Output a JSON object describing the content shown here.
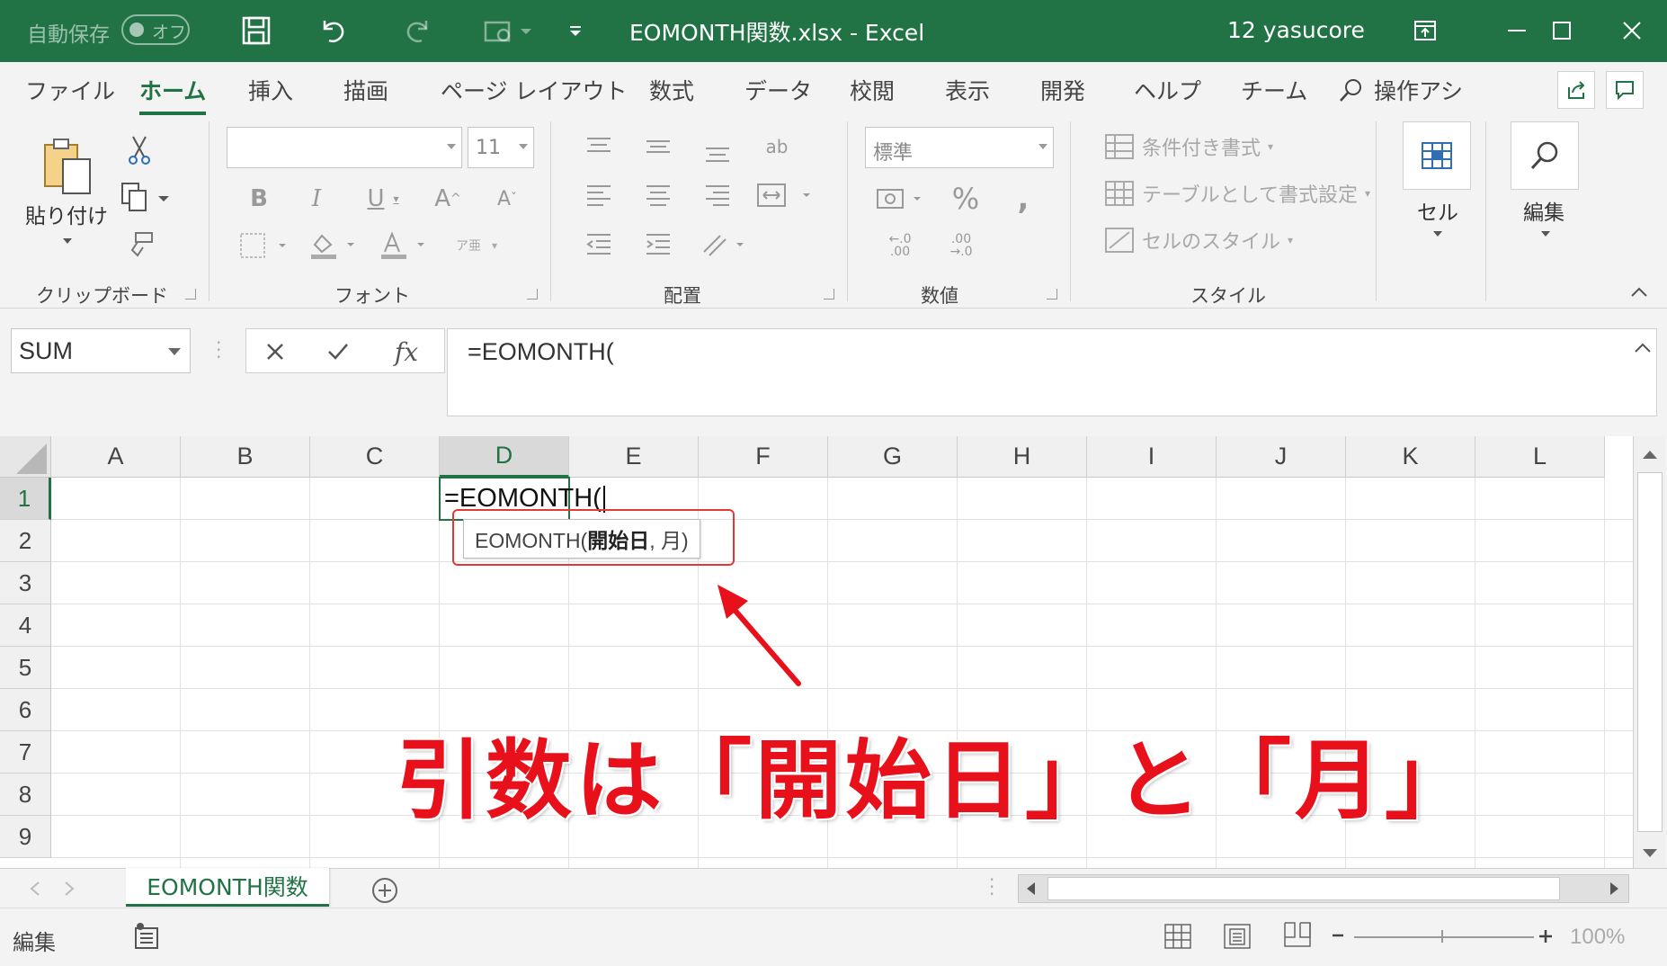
{
  "titlebar": {
    "autosave": "自動保存",
    "toggle_state": "オフ",
    "doc_title": "EOMONTH関数.xlsx  -  Excel",
    "user": "12 yasucore"
  },
  "tabs": [
    "ファイル",
    "ホーム",
    "挿入",
    "描画",
    "ページ レイアウト",
    "数式",
    "データ",
    "校閲",
    "表示",
    "開発",
    "ヘルプ",
    "チーム"
  ],
  "search_label": "操作アシ",
  "ribbon": {
    "clipboard": {
      "paste_label": "貼り付け",
      "group_label": "クリップボード"
    },
    "font": {
      "font_name": "",
      "font_size": "11",
      "group_label": "フォント"
    },
    "alignment": {
      "group_label": "配置"
    },
    "number": {
      "format": "標準",
      "group_label": "数値"
    },
    "styles": {
      "conditional": "条件付き書式",
      "as_table": "テーブルとして書式設定",
      "cell_styles": "セルのスタイル",
      "group_label": "スタイル"
    },
    "cells_label": "セル",
    "edit_label": "編集"
  },
  "formula_bar": {
    "name_box": "SUM",
    "formula": "=EOMONTH("
  },
  "grid": {
    "columns": [
      "A",
      "B",
      "C",
      "D",
      "E",
      "F",
      "G",
      "H",
      "I",
      "J",
      "K",
      "L"
    ],
    "active_column": "D",
    "rows": [
      "1",
      "2",
      "3",
      "4",
      "5",
      "6",
      "7",
      "8",
      "9"
    ],
    "active_row": "1",
    "active_cell_text": "=EOMONTH("
  },
  "tooltip": {
    "prefix": "EOMONTH(",
    "arg1": "開始日",
    "rest": ", 月)"
  },
  "annotation": "引数は「開始日」と「月」",
  "sheet_tab": "EOMONTH関数",
  "status": {
    "mode": "編集",
    "zoom": "100%"
  },
  "colors": {
    "excel_green": "#217346",
    "annotation_red": "#e8111b"
  }
}
